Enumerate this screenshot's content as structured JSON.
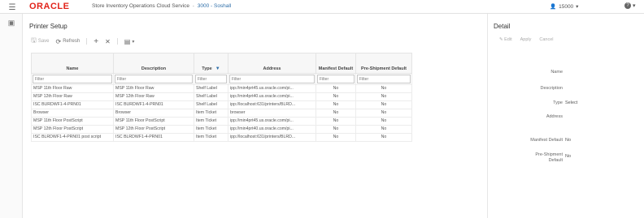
{
  "header": {
    "logo": "ORACLE",
    "app_title": "Store Inventory Operations Cloud Service",
    "separator": "-",
    "store": "3000 - Soshall",
    "user": "15000",
    "help": "?"
  },
  "page": {
    "title": "Printer Setup"
  },
  "toolbar": {
    "save": "Save",
    "refresh": "Refresh",
    "add": "+",
    "remove": "✕",
    "view": "▤"
  },
  "grid": {
    "columns": [
      "Name",
      "Description",
      "Type",
      "Address",
      "Manifest Default",
      "Pre-Shipment Default"
    ],
    "filter_placeholder": "Filter",
    "rows": [
      [
        "MSP 11th Floor Raw",
        "MSP 11th Floor Raw",
        "Shelf Label",
        "ipp://min4prt45.us.oracle.com/pi...",
        "No",
        "No"
      ],
      [
        "MSP 12th Floor Raw",
        "MSP 12th Floor Raw",
        "Shelf Label",
        "ipp://min4prt40.us.oracle.com/pi...",
        "No",
        "No"
      ],
      [
        "ISC BURDWF1-4-PRN01",
        "ISC BURDWF1-4-PRN01",
        "Shelf Label",
        "ipp://localhost:631/printers/BLRD...",
        "No",
        "No"
      ],
      [
        "Browser",
        "Browser",
        "Item Ticket",
        "browser",
        "No",
        "No"
      ],
      [
        "MSP 11th Floor PostScript",
        "MSP 11th Floor PostScript",
        "Item Ticket",
        "ipp://min4prt45.us.oracle.com/pi...",
        "No",
        "No"
      ],
      [
        "MSP 12th Floor PostScript",
        "MSP 12th Floor PostScript",
        "Item Ticket",
        "ipp://min4prt40.us.oracle.com/pi...",
        "No",
        "No"
      ],
      [
        "ISC BLRDWF1-4-PRN01 post script",
        "ISC BLRDWF1-4-PRN01",
        "Item Ticket",
        "ipp://localhost:631/printers/BLRD...",
        "No",
        "No"
      ]
    ]
  },
  "detail": {
    "title": "Detail",
    "edit": "Edit",
    "apply": "Apply",
    "cancel": "Cancel",
    "labels": {
      "name": "Name",
      "description": "Description",
      "type": "Type",
      "address": "Address",
      "manifest_default": "Manifest Default",
      "pre_shipment_default": "Pre-Shipment Default"
    },
    "values": {
      "type": "Select",
      "manifest_default": "No",
      "pre_shipment_default": "No"
    }
  }
}
